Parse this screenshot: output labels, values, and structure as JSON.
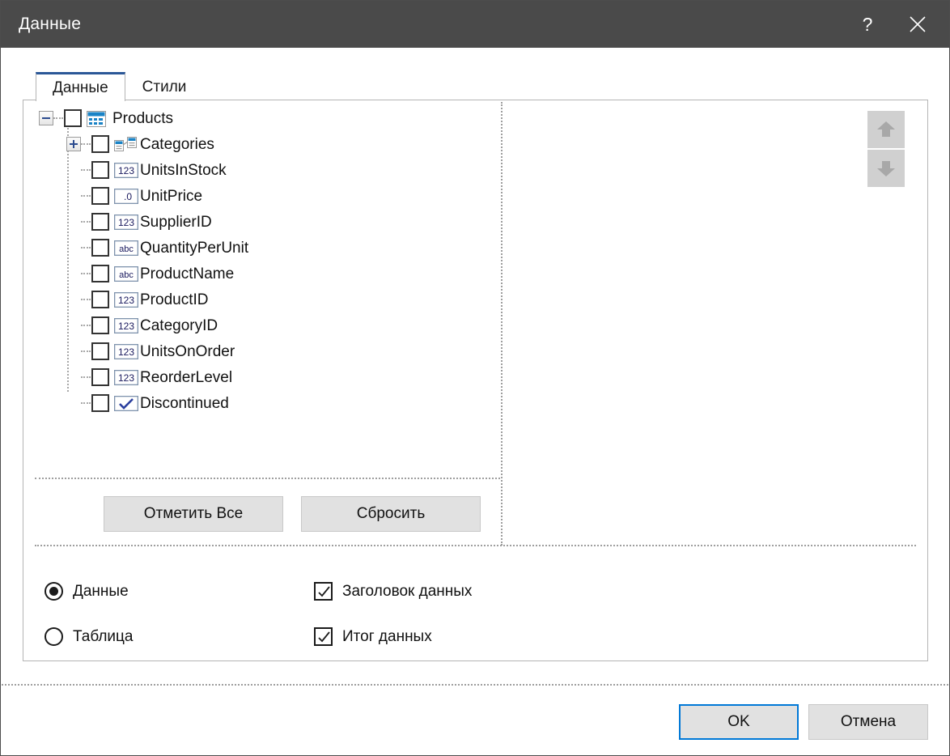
{
  "window": {
    "title": "Данные",
    "help_label": "?",
    "close_label": "✕",
    "titlebar_bg": "#4a4a4a",
    "accent": "#0078d7",
    "tab_accent": "#2b5797"
  },
  "tabs": [
    {
      "label": "Данные",
      "active": true
    },
    {
      "label": "Стили",
      "active": false
    }
  ],
  "tree": {
    "root": {
      "label": "Products",
      "icon": "table-icon",
      "expander": "minus",
      "checked": false
    },
    "children": [
      {
        "label": "Categories",
        "icon": "relation-icon",
        "expander": "plus",
        "checked": false
      },
      {
        "label": "UnitsInStock",
        "icon": "integer-icon",
        "expander": "none",
        "checked": false
      },
      {
        "label": "UnitPrice",
        "icon": "decimal-icon",
        "expander": "none",
        "checked": false
      },
      {
        "label": "SupplierID",
        "icon": "integer-icon",
        "expander": "none",
        "checked": false
      },
      {
        "label": "QuantityPerUnit",
        "icon": "text-icon",
        "expander": "none",
        "checked": false
      },
      {
        "label": "ProductName",
        "icon": "text-icon",
        "expander": "none",
        "checked": false
      },
      {
        "label": "ProductID",
        "icon": "integer-icon",
        "expander": "none",
        "checked": false
      },
      {
        "label": "CategoryID",
        "icon": "integer-icon",
        "expander": "none",
        "checked": false
      },
      {
        "label": "UnitsOnOrder",
        "icon": "integer-icon",
        "expander": "none",
        "checked": false
      },
      {
        "label": "ReorderLevel",
        "icon": "integer-icon",
        "expander": "none",
        "checked": false
      },
      {
        "label": "Discontinued",
        "icon": "boolean-icon",
        "expander": "none",
        "checked": false
      }
    ],
    "icon_text": {
      "integer": "123",
      "decimal": ".0",
      "text": "abc"
    }
  },
  "tree_buttons": {
    "mark_all": "Отметить Все",
    "reset": "Сбросить"
  },
  "right_panel": {
    "move_up": "move-up-arrow",
    "move_down": "move-down-arrow",
    "items": []
  },
  "options": {
    "radios": [
      {
        "label": "Данные",
        "selected": true
      },
      {
        "label": "Таблица",
        "selected": false
      }
    ],
    "checkboxes": [
      {
        "label": "Заголовок данных",
        "checked": true
      },
      {
        "label": "Итог данных",
        "checked": true
      }
    ]
  },
  "footer": {
    "ok": "OK",
    "cancel": "Отмена"
  }
}
